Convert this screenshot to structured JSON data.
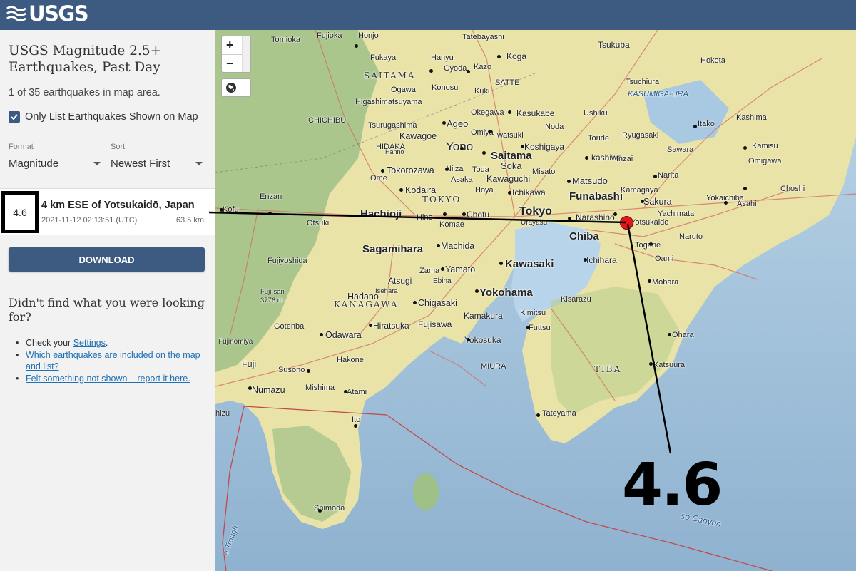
{
  "header": {
    "logo_text": "USGS"
  },
  "sidebar": {
    "title": "USGS Magnitude 2.5+ Earthquakes, Past Day",
    "count_text": "1 of 35 earthquakes in map area.",
    "only_list_label": "Only List Earthquakes Shown on Map",
    "only_list_checked": true,
    "format_label": "Format",
    "format_value": "Magnitude",
    "sort_label": "Sort",
    "sort_value": "Newest First",
    "download_label": "DOWNLOAD",
    "help_title": "Didn't find what you were looking for?",
    "help": {
      "check_prefix": "Check your ",
      "settings_link": "Settings",
      "check_suffix": ".",
      "which_link": "Which earthquakes are included on the map and list?",
      "felt_link": "Felt something not shown – report it here."
    }
  },
  "earthquake": {
    "magnitude": "4.6",
    "place": "4 km ESE of Yotsukaidō, Japan",
    "time": "2021-11-12 02:13:51 (UTC)",
    "depth": "63.5 km"
  },
  "map": {
    "zoom_in": "+",
    "zoom_out": "−",
    "annotation_magnitude": "4.6",
    "marker_color": "#e8141b",
    "labels": {
      "tomioka": "Tomioka",
      "fujioka": "Fujioka",
      "honjo": "Honjo",
      "tatebayashi": "Tatebayashi",
      "tsukuba": "Tsukuba",
      "fukaya": "Fukaya",
      "hanyu": "Hanyu",
      "koga": "Koga",
      "hokota": "Hokota",
      "saitama_pref": "SAITAMA",
      "gyoda": "Gyoda",
      "kazo": "Kazo",
      "satte": "SATTE",
      "tsuchiura": "Tsuchiura",
      "ogawa": "Ogawa",
      "konosu": "Konosu",
      "kuki": "Kuki",
      "kasumigaura": "KASUMIGA-URA",
      "higashimatsuyama": "Higashimatsuyama",
      "okegawa": "Okegawa",
      "kasukabe": "Kasukabe",
      "ushiku": "Ushiku",
      "kashima": "Kashima",
      "chichibu": "CHICHIBU",
      "tsurugashima": "Tsurugashima",
      "ageo": "Ageo",
      "noda": "Noda",
      "itako": "Itako",
      "kawagoe": "Kawagoe",
      "omiya": "Omiya",
      "iwatsuki": "Iwatsuki",
      "toride": "Toride",
      "ryugasaki": "Ryugasaki",
      "kamisu": "Kamisu",
      "hidaka": "HIDAKA",
      "hanno": "Hanno",
      "yono": "Yono",
      "koshigaya": "Koshigaya",
      "sawara": "Sawara",
      "saitama": "Saitama",
      "kashiwa": "kashiwa",
      "inzai": "Inzai",
      "omigawa": "Omigawa",
      "tokorozawa": "Tokorozawa",
      "niiza": "Niiza",
      "toda": "Toda",
      "soka": "Soka",
      "misato": "Misato",
      "narita": "Narita",
      "ome": "Ome",
      "asaka": "Asaka",
      "kawaguchi": "Kawaguchi",
      "matsudo": "Matsudo",
      "choshi": "Choshi",
      "kodaira": "Kodaira",
      "hoya": "Hoya",
      "ichikawa": "Ichikawa",
      "kamagaya": "Kamagaya",
      "enzan": "Enzan",
      "tokyo_pref": "TŌKYŌ",
      "funabashi": "Funabashi",
      "sakura": "Sakura",
      "yokaichiba": "Yokaichiba",
      "asahi": "Asahi",
      "kofu": "Kofu",
      "hachioji": "Hachioji",
      "hino": "Hino",
      "chofu": "Chofu",
      "tokyo": "Tokyo",
      "narashino": "Narashino",
      "yotsukaido": "Yotsukaido",
      "yachimata": "Yachimata",
      "otsuki": "Otsuki",
      "komae": "Komae",
      "urayasu": "Urayasu",
      "chiba": "Chiba",
      "naruto": "Naruto",
      "togane": "Togane",
      "sagamihara": "Sagamihara",
      "machida": "Machida",
      "fujiyoshida": "Fujiyoshida",
      "ichihara": "Ichihara",
      "oami": "Oami",
      "zama": "Zama",
      "yamato": "Yamato",
      "kawasaki": "Kawasaki",
      "atsugi": "Atsugi",
      "ebina": "Ebina",
      "mobara": "Mobara",
      "fujisan": "Fuji-san",
      "fujisan_elev": "3776 m",
      "isehara": "Isehara",
      "hadano": "Hadano",
      "yokohama": "Yokohama",
      "kisarazu": "Kisarazu",
      "kanagawa_pref": "KANAGAWA",
      "chigasaki": "Chigasaki",
      "kimitsu": "Kimitsu",
      "kamakura": "Kamakura",
      "gotenba": "Gotenba",
      "hiratsuka": "Hiratsuka",
      "fujisawa": "Fujisawa",
      "futtsu": "Futtsu",
      "ohara": "Ohara",
      "odawara": "Odawara",
      "fujinomiya": "Fujinomiya",
      "yokosuka": "Yokosuka",
      "hakone": "Hakone",
      "katsuura": "Katsuura",
      "fuji": "Fuji",
      "susono": "Susono",
      "miura": "MIURA",
      "chiba_pref": "TIBA",
      "numazu": "Numazu",
      "mishima": "Mishima",
      "atami": "Atami",
      "shimizu": "hizu",
      "tateyama": "Tateyama",
      "ito": "Ito",
      "shimoda": "Shimoda",
      "canyon": "so Canyon",
      "trough": "a Trough"
    }
  }
}
